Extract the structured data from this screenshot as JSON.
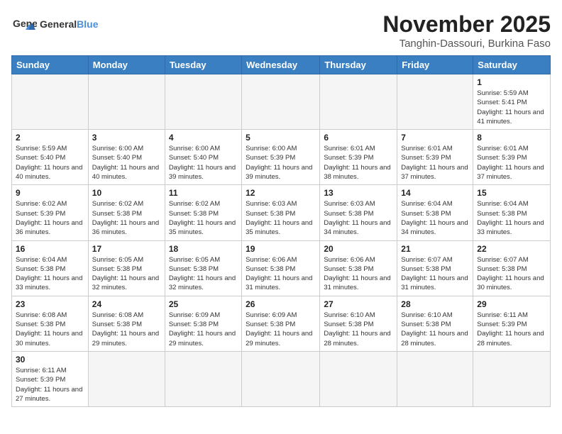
{
  "header": {
    "logo_text_normal": "General",
    "logo_text_accent": "Blue",
    "month": "November 2025",
    "location": "Tanghin-Dassouri, Burkina Faso"
  },
  "weekdays": [
    "Sunday",
    "Monday",
    "Tuesday",
    "Wednesday",
    "Thursday",
    "Friday",
    "Saturday"
  ],
  "weeks": [
    [
      {
        "day": "",
        "info": ""
      },
      {
        "day": "",
        "info": ""
      },
      {
        "day": "",
        "info": ""
      },
      {
        "day": "",
        "info": ""
      },
      {
        "day": "",
        "info": ""
      },
      {
        "day": "",
        "info": ""
      },
      {
        "day": "1",
        "info": "Sunrise: 5:59 AM\nSunset: 5:41 PM\nDaylight: 11 hours and 41 minutes."
      }
    ],
    [
      {
        "day": "2",
        "info": "Sunrise: 5:59 AM\nSunset: 5:40 PM\nDaylight: 11 hours and 40 minutes."
      },
      {
        "day": "3",
        "info": "Sunrise: 6:00 AM\nSunset: 5:40 PM\nDaylight: 11 hours and 40 minutes."
      },
      {
        "day": "4",
        "info": "Sunrise: 6:00 AM\nSunset: 5:40 PM\nDaylight: 11 hours and 39 minutes."
      },
      {
        "day": "5",
        "info": "Sunrise: 6:00 AM\nSunset: 5:39 PM\nDaylight: 11 hours and 39 minutes."
      },
      {
        "day": "6",
        "info": "Sunrise: 6:01 AM\nSunset: 5:39 PM\nDaylight: 11 hours and 38 minutes."
      },
      {
        "day": "7",
        "info": "Sunrise: 6:01 AM\nSunset: 5:39 PM\nDaylight: 11 hours and 37 minutes."
      },
      {
        "day": "8",
        "info": "Sunrise: 6:01 AM\nSunset: 5:39 PM\nDaylight: 11 hours and 37 minutes."
      }
    ],
    [
      {
        "day": "9",
        "info": "Sunrise: 6:02 AM\nSunset: 5:39 PM\nDaylight: 11 hours and 36 minutes."
      },
      {
        "day": "10",
        "info": "Sunrise: 6:02 AM\nSunset: 5:38 PM\nDaylight: 11 hours and 36 minutes."
      },
      {
        "day": "11",
        "info": "Sunrise: 6:02 AM\nSunset: 5:38 PM\nDaylight: 11 hours and 35 minutes."
      },
      {
        "day": "12",
        "info": "Sunrise: 6:03 AM\nSunset: 5:38 PM\nDaylight: 11 hours and 35 minutes."
      },
      {
        "day": "13",
        "info": "Sunrise: 6:03 AM\nSunset: 5:38 PM\nDaylight: 11 hours and 34 minutes."
      },
      {
        "day": "14",
        "info": "Sunrise: 6:04 AM\nSunset: 5:38 PM\nDaylight: 11 hours and 34 minutes."
      },
      {
        "day": "15",
        "info": "Sunrise: 6:04 AM\nSunset: 5:38 PM\nDaylight: 11 hours and 33 minutes."
      }
    ],
    [
      {
        "day": "16",
        "info": "Sunrise: 6:04 AM\nSunset: 5:38 PM\nDaylight: 11 hours and 33 minutes."
      },
      {
        "day": "17",
        "info": "Sunrise: 6:05 AM\nSunset: 5:38 PM\nDaylight: 11 hours and 32 minutes."
      },
      {
        "day": "18",
        "info": "Sunrise: 6:05 AM\nSunset: 5:38 PM\nDaylight: 11 hours and 32 minutes."
      },
      {
        "day": "19",
        "info": "Sunrise: 6:06 AM\nSunset: 5:38 PM\nDaylight: 11 hours and 31 minutes."
      },
      {
        "day": "20",
        "info": "Sunrise: 6:06 AM\nSunset: 5:38 PM\nDaylight: 11 hours and 31 minutes."
      },
      {
        "day": "21",
        "info": "Sunrise: 6:07 AM\nSunset: 5:38 PM\nDaylight: 11 hours and 31 minutes."
      },
      {
        "day": "22",
        "info": "Sunrise: 6:07 AM\nSunset: 5:38 PM\nDaylight: 11 hours and 30 minutes."
      }
    ],
    [
      {
        "day": "23",
        "info": "Sunrise: 6:08 AM\nSunset: 5:38 PM\nDaylight: 11 hours and 30 minutes."
      },
      {
        "day": "24",
        "info": "Sunrise: 6:08 AM\nSunset: 5:38 PM\nDaylight: 11 hours and 29 minutes."
      },
      {
        "day": "25",
        "info": "Sunrise: 6:09 AM\nSunset: 5:38 PM\nDaylight: 11 hours and 29 minutes."
      },
      {
        "day": "26",
        "info": "Sunrise: 6:09 AM\nSunset: 5:38 PM\nDaylight: 11 hours and 29 minutes."
      },
      {
        "day": "27",
        "info": "Sunrise: 6:10 AM\nSunset: 5:38 PM\nDaylight: 11 hours and 28 minutes."
      },
      {
        "day": "28",
        "info": "Sunrise: 6:10 AM\nSunset: 5:38 PM\nDaylight: 11 hours and 28 minutes."
      },
      {
        "day": "29",
        "info": "Sunrise: 6:11 AM\nSunset: 5:39 PM\nDaylight: 11 hours and 28 minutes."
      }
    ],
    [
      {
        "day": "30",
        "info": "Sunrise: 6:11 AM\nSunset: 5:39 PM\nDaylight: 11 hours and 27 minutes."
      },
      {
        "day": "",
        "info": ""
      },
      {
        "day": "",
        "info": ""
      },
      {
        "day": "",
        "info": ""
      },
      {
        "day": "",
        "info": ""
      },
      {
        "day": "",
        "info": ""
      },
      {
        "day": "",
        "info": ""
      }
    ]
  ]
}
